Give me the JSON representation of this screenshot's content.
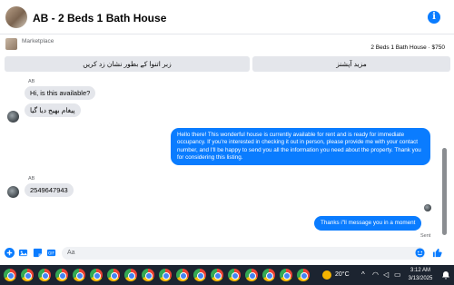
{
  "header": {
    "title": "AB - 2 Beds 1 Bath House",
    "info_icon": "i"
  },
  "marketplace": {
    "label": "Marketplace",
    "listing": "2 Beds 1 Bath House · $750"
  },
  "actions": {
    "left_button": "زبر اتنوا کے بطور نشان زد کریں",
    "right_button": "مزید آپشنز"
  },
  "messages": [
    {
      "sender": "AB",
      "text": "Hi, is this available?"
    },
    {
      "text": "پیغام بھیج دیا گیا"
    },
    {
      "text": "Hello there! This wonderful house is currently available for rent and is ready for immediate occupancy. If you're interested in checking it out in person, please provide me with your contact number, and I'll be happy to send you all the information you need about the property. Thank you for considering this listing."
    },
    {
      "sender": "AB",
      "text": "2549647943"
    },
    {
      "text": "Thanks i\"ll message you in a moment",
      "status": "Sent"
    }
  ],
  "composer": {
    "placeholder": "Aa"
  },
  "taskbar": {
    "temperature": "20°C",
    "time": "3:12 AM",
    "date": "3/13/2025"
  },
  "colors": {
    "accent": "#0a7cff",
    "incoming_bubble": "#e4e6eb",
    "taskbar": "#1c2430"
  }
}
